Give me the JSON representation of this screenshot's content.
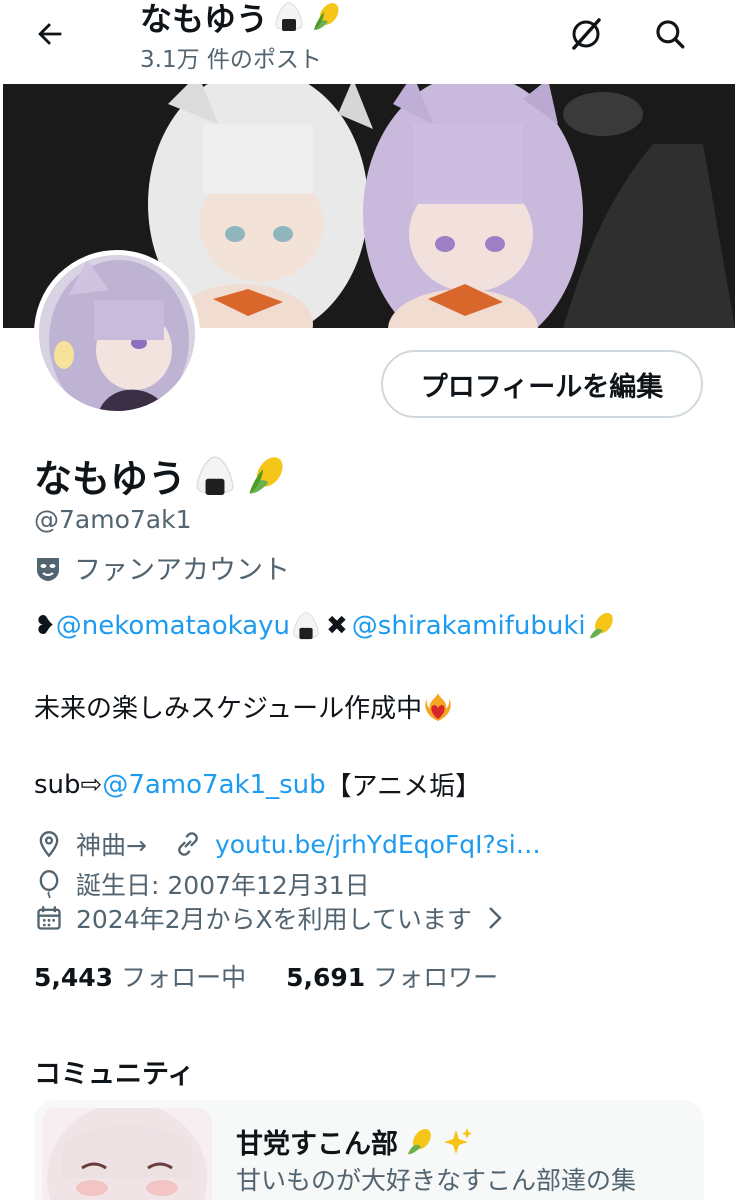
{
  "header": {
    "title": "なもゆう",
    "post_count": "3.1万 件のポスト",
    "icons": [
      "back-arrow-icon",
      "grok-icon",
      "search-icon"
    ]
  },
  "profile": {
    "display_name": "なもゆう",
    "name_emojis": [
      "onigiri",
      "corn"
    ],
    "handle": "@7amo7ak1",
    "category": "ファンアカウント",
    "category_icon": "theater-mask-icon",
    "edit_button": "プロフィールを編集"
  },
  "bio": {
    "line1_prefix": "❥",
    "mention1": "@nekomataokayu",
    "mention2": "@shirakamifubuki",
    "cross": "✖",
    "line2": "未来の楽しみスケジュール作成中",
    "line3_prefix": "sub⇨",
    "mention3": "@7amo7ak1_sub",
    "line3_suffix": "【アニメ垢】"
  },
  "meta": {
    "location": "神曲→",
    "link": "youtu.be/jrhYdEqoFqI?si…",
    "birthday": "誕生日: 2007年12月31日",
    "joined": "2024年2月からXを利用しています"
  },
  "stats": {
    "following_count": "5,443",
    "following_label": "フォロー中",
    "followers_count": "5,691",
    "followers_label": "フォロワー"
  },
  "community": {
    "heading": "コミュニティ",
    "title": "甘党すこん部",
    "description": "甘いものが大好きなすこん部達の集"
  },
  "colors": {
    "accent": "#1d9bf0",
    "secondary_text": "#536471",
    "border": "#cfd9de"
  }
}
